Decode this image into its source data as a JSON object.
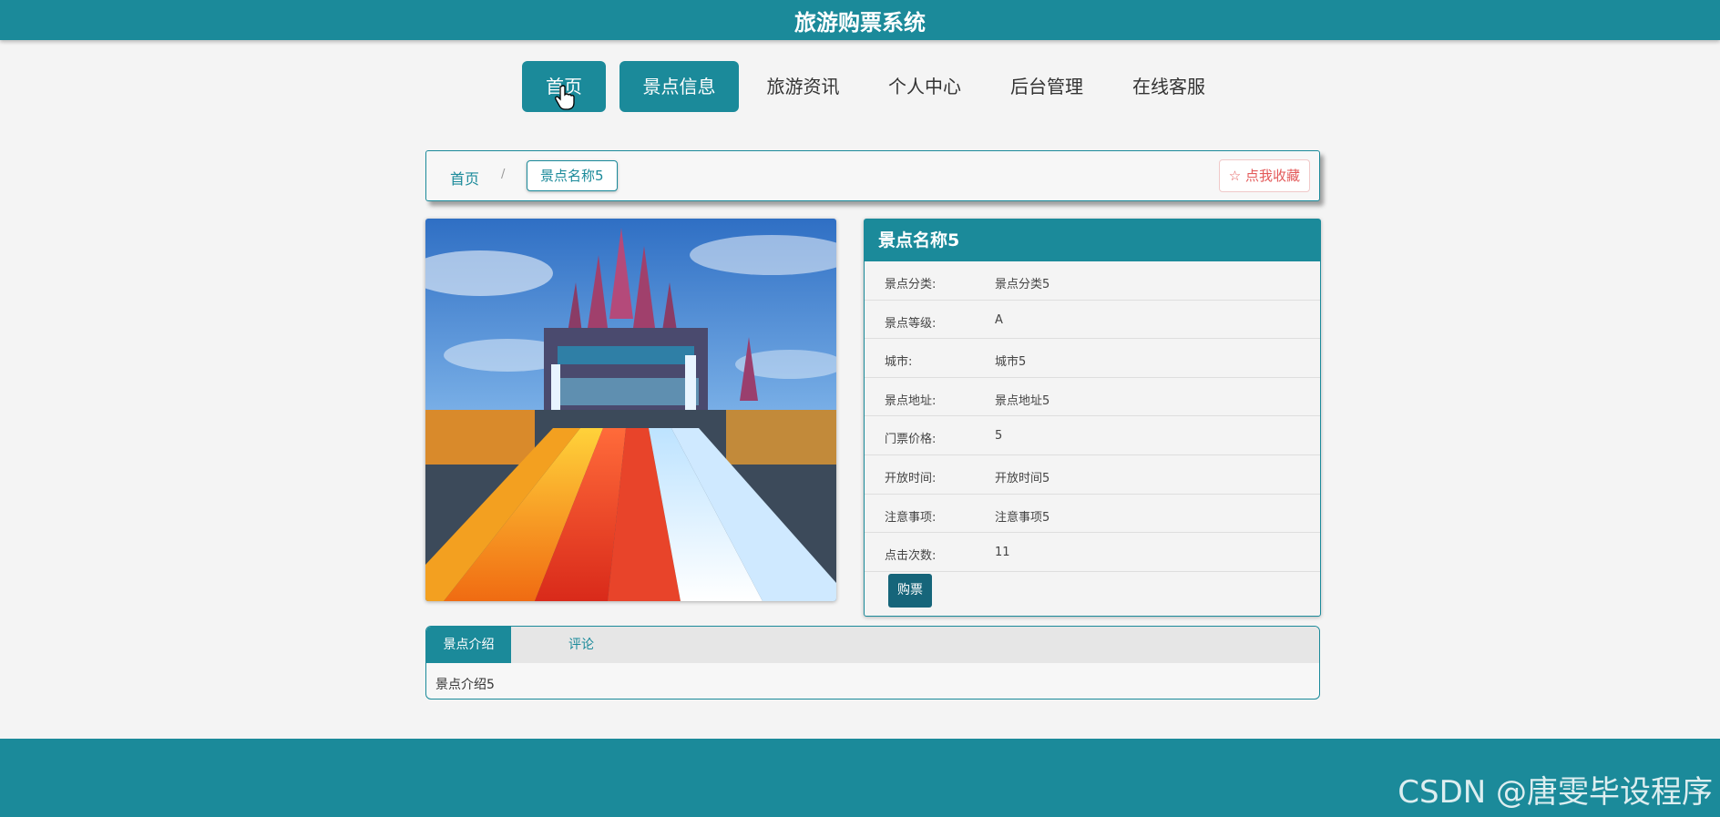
{
  "header": {
    "title": "旅游购票系统"
  },
  "nav": {
    "items": [
      {
        "label": "首页"
      },
      {
        "label": "景点信息"
      },
      {
        "label": "旅游资讯"
      },
      {
        "label": "个人中心"
      },
      {
        "label": "后台管理"
      },
      {
        "label": "在线客服"
      }
    ]
  },
  "breadcrumb": {
    "home": "首页",
    "separator": "/",
    "current": "景点名称5"
  },
  "favorite": {
    "label": "☆ 点我收藏"
  },
  "detail": {
    "title": "景点名称5",
    "rows": [
      {
        "key": "景点分类:",
        "value": "景点分类5"
      },
      {
        "key": "景点等级:",
        "value": "A"
      },
      {
        "key": "城市:",
        "value": "城市5"
      },
      {
        "key": "景点地址:",
        "value": "景点地址5"
      },
      {
        "key": "门票价格:",
        "value": "5"
      },
      {
        "key": "开放时间:",
        "value": "开放时间5"
      },
      {
        "key": "注意事项:",
        "value": "注意事项5"
      },
      {
        "key": "点击次数:",
        "value": "11"
      }
    ],
    "buy_label": "购票"
  },
  "tabs": {
    "items": [
      {
        "label": "景点介绍"
      },
      {
        "label": "评论"
      }
    ],
    "content": "景点介绍5"
  },
  "footer": {
    "watermark": "CSDN @唐雯毕设程序"
  },
  "colors": {
    "primary": "#1b8a9a",
    "buy": "#16657a",
    "favorite": "#e35a5a"
  }
}
